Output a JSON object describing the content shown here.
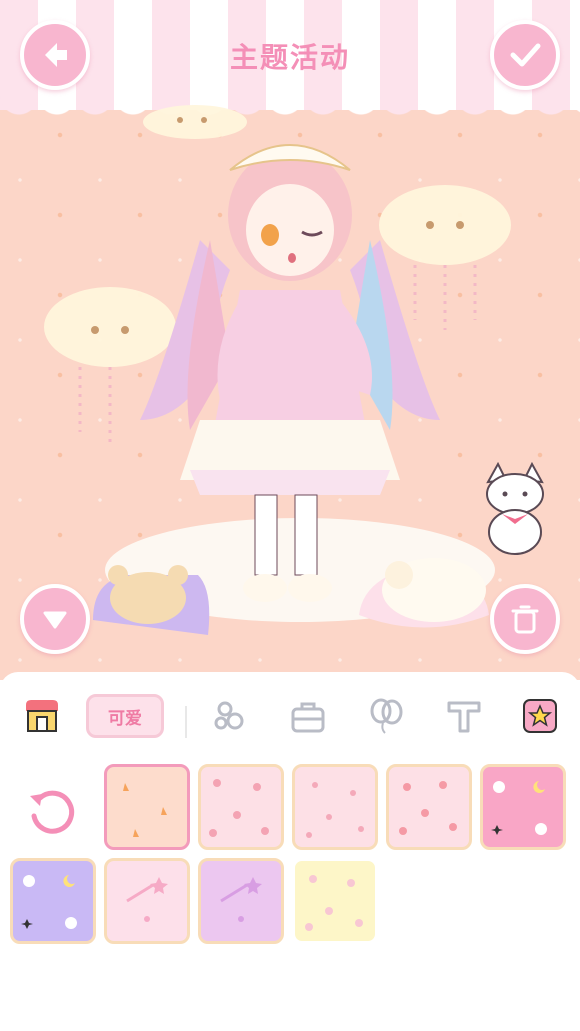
{
  "header": {
    "title": "主题活动",
    "back_icon": "back-arrow-icon",
    "confirm_icon": "checkmark-icon"
  },
  "scene": {
    "collapse_icon": "triangle-down-icon",
    "delete_icon": "trash-icon"
  },
  "toolbar": {
    "tabs": [
      {
        "icon": "shop-icon",
        "active": false
      },
      {
        "label": "可爱",
        "active": true
      },
      {
        "icon": "flower-icon",
        "active": false
      },
      {
        "icon": "bag-icon",
        "active": false
      },
      {
        "icon": "balloon-icon",
        "active": false
      },
      {
        "icon": "text-icon",
        "active": false
      },
      {
        "icon": "star-badge-icon",
        "active": false
      }
    ]
  },
  "backgrounds": {
    "reset_icon": "reset-icon",
    "swatches": [
      {
        "name": "peach-carrots",
        "color": "#fddccc",
        "pattern": "carrot",
        "selected": true
      },
      {
        "name": "pink-strawberries",
        "color": "#fde0e6",
        "pattern": "strawberry",
        "selected": false
      },
      {
        "name": "pink-dots",
        "color": "#fde0e6",
        "pattern": "dot",
        "selected": false
      },
      {
        "name": "pink-peaches",
        "color": "#fde0e6",
        "pattern": "peach",
        "selected": false
      },
      {
        "name": "hot-pink-bunnies",
        "color": "#f9a6c6",
        "pattern": "bunny",
        "selected": false
      },
      {
        "name": "lavender-bunnies",
        "color": "#c9b9f5",
        "pattern": "bunny",
        "selected": false
      },
      {
        "name": "pink-shooting-stars",
        "color": "#fde0ea",
        "pattern": "shooting-star",
        "selected": false
      },
      {
        "name": "lilac-shooting-stars",
        "color": "#ecc7f0",
        "pattern": "shooting-star",
        "selected": false
      },
      {
        "name": "cream-flowers",
        "color": "#fdf6c8",
        "pattern": "flower",
        "selected": false
      }
    ]
  },
  "colors": {
    "accent": "#f8b6cf",
    "title": "#f48fb7",
    "scene_bg": "#fcd6c8"
  }
}
